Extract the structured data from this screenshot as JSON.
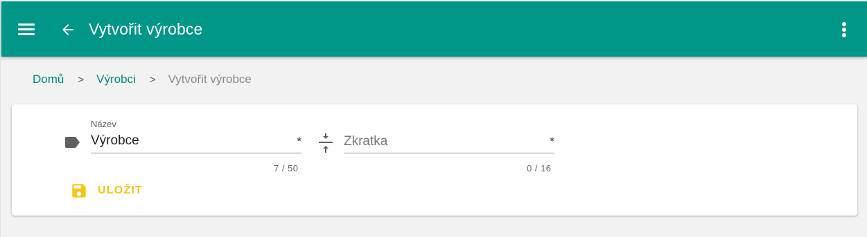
{
  "app_bar": {
    "title": "Vytvořit výrobce",
    "menu_icon": "menu-icon",
    "back_icon": "arrow-back-icon",
    "more_icon": "more-vert-icon",
    "color": "#009688"
  },
  "breadcrumb": {
    "items": [
      {
        "label": "Domů"
      },
      {
        "label": "Výrobci"
      },
      {
        "label": "Vytvořit výrobce"
      }
    ],
    "separator": ">"
  },
  "form": {
    "name_field": {
      "label": "Název",
      "value": "Výrobce",
      "required_marker": "*",
      "counter": "7 / 50",
      "icon": "label-icon"
    },
    "abbreviation_field": {
      "placeholder": "Zkratka",
      "value": "",
      "required_marker": "*",
      "counter": "0 / 16",
      "icon": "compress-icon"
    },
    "save_button": {
      "label": "ULOŽIT",
      "icon": "save-icon",
      "color": "#f5c518"
    }
  }
}
